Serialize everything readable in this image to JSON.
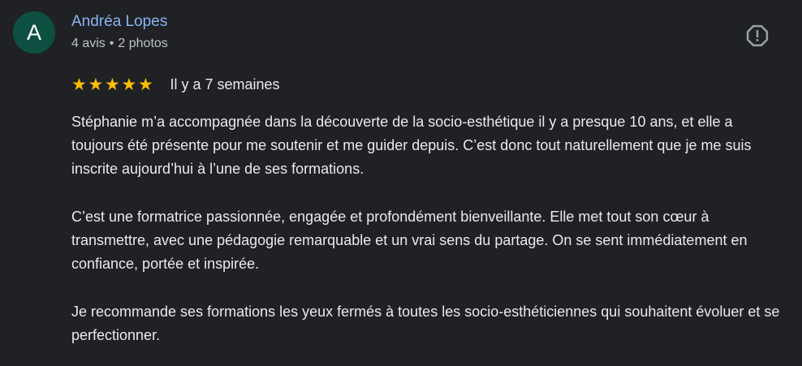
{
  "review": {
    "author": {
      "initial": "A",
      "name": "Andréa Lopes",
      "reviews_count": "4 avis",
      "separator": "•",
      "photos_count": "2 photos",
      "avatar_color": "#0d5042"
    },
    "rating": 5,
    "rating_max": 5,
    "date": "Il y a 7 semaines",
    "paragraphs": [
      "Stéphanie m’a accompagnée dans la découverte de la socio-esthétique il y a presque 10 ans, et elle a toujours été présente pour me soutenir et me guider depuis. C’est donc tout naturellement que je me suis inscrite aujourd’hui à l’une de ses formations.",
      "C’est une formatrice passionnée, engagée et profondément bienveillante. Elle met tout son cœur à transmettre, avec une pédagogie remarquable et un vrai sens du partage. On se sent immédiatement en confiance, portée et inspirée.",
      "Je recommande ses formations les yeux fermés à toutes les socio-esthéticiennes qui souhaitent évoluer et se perfectionner."
    ],
    "report_icon": "report-flag-icon"
  },
  "colors": {
    "background": "#202124",
    "author_name": "#8ab4f8",
    "star": "#fbbc04",
    "text": "#e8eaed",
    "meta": "#bdc1c6"
  }
}
